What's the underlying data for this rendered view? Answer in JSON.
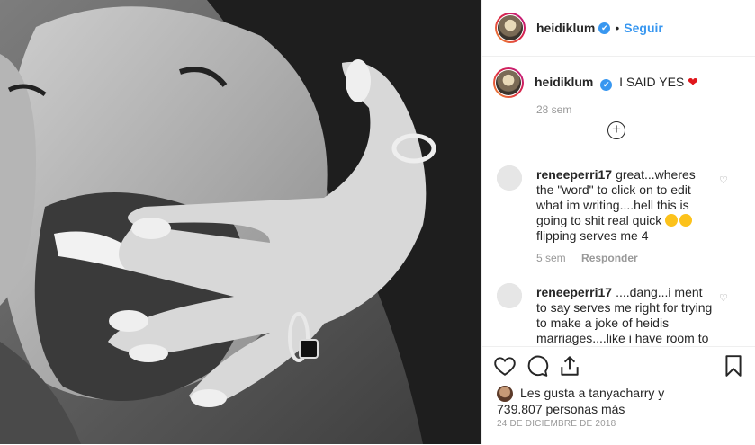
{
  "post_image": {
    "alt": ""
  },
  "header": {
    "username": "heidiklum",
    "separator": "•",
    "follow_label": "Seguir",
    "verified_glyph": "✔"
  },
  "caption": {
    "username": "heidiklum",
    "text": "I SAID YES",
    "heart": "❤",
    "time": "28 sem"
  },
  "load_more": {
    "glyph": "+"
  },
  "comments": [
    {
      "username": "reneeperri17",
      "text": "great...wheres the \"word\" to click on to edit what im writing....hell this is going to shit real quick",
      "text_after_emoji": "flipping serves me 4",
      "time": "5 sem",
      "reply_label": "Responder",
      "like_glyph": "♡"
    },
    {
      "username": "reneeperri17",
      "text": "....dang...i ment to say serves me right for trying to make a joke of heidis marriages....like i have room to",
      "like_glyph": "♡"
    }
  ],
  "actions": {
    "like_icon": "heart-icon",
    "comment_icon": "comment-icon",
    "share_icon": "share-icon",
    "save_icon": "bookmark-icon"
  },
  "likes": {
    "line1": "Les gusta a tanyacharry y",
    "line2": "739.807 personas más"
  },
  "date": "24 DE DICIEMBRE DE 2018"
}
